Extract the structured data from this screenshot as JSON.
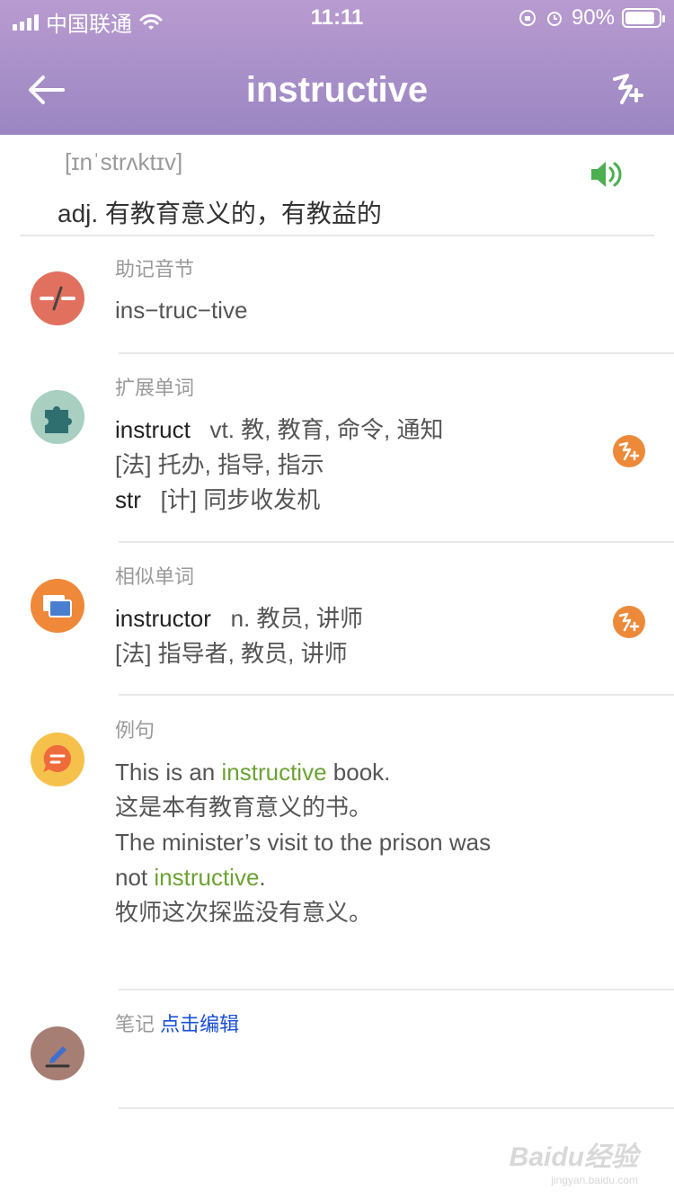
{
  "status": {
    "carrier": "中国联通",
    "time": "11:11",
    "battery": "90%",
    "battery_level": 0.9
  },
  "header": {
    "title": "instructive",
    "back_icon": "back-arrow-icon",
    "add_icon": "add-wordbook-icon"
  },
  "word": {
    "phonetic": "[ɪnˈstrʌktɪv]",
    "definition": "adj. 有教育意义的，有教益的",
    "speaker_color": "#4caf50"
  },
  "mnemonic": {
    "label": "助记音节",
    "value": "ins−truc−tive",
    "icon_color": "#e2705f"
  },
  "extended": {
    "label": "扩展单词",
    "icon_color": "#a9cfc0",
    "lines": [
      {
        "en": "instruct",
        "cn": "vt. 教, 教育, 命令, 通知"
      },
      {
        "en": "",
        "cn": "[法] 托办, 指导, 指示"
      },
      {
        "en": "str",
        "cn": "[计] 同步收发机"
      }
    ]
  },
  "similar": {
    "label": "相似单词",
    "icon_color": "#f0883a",
    "lines": [
      {
        "en": "instructor",
        "cn": "n. 教员, 讲师"
      },
      {
        "en": "",
        "cn": "[法] 指导者, 教员, 讲师"
      }
    ]
  },
  "examples": {
    "label": "例句",
    "icon_color": "#f6c14a",
    "line1_pre": "This is an ",
    "line1_hl": "instructive",
    "line1_post": " book.",
    "line2": "这是本有教育意义的书。",
    "line3": "The minister’s visit to the prison was",
    "line4_pre": "not ",
    "line4_hl": "instructive",
    "line4_post": ".",
    "line5": "牧师这次探监没有意义。"
  },
  "notes": {
    "label": "笔记",
    "edit_label": "点击编辑",
    "icon_color": "#a77e74"
  },
  "watermark": {
    "text": "Baidu经验",
    "sub": "jingyan.baidu.com"
  }
}
